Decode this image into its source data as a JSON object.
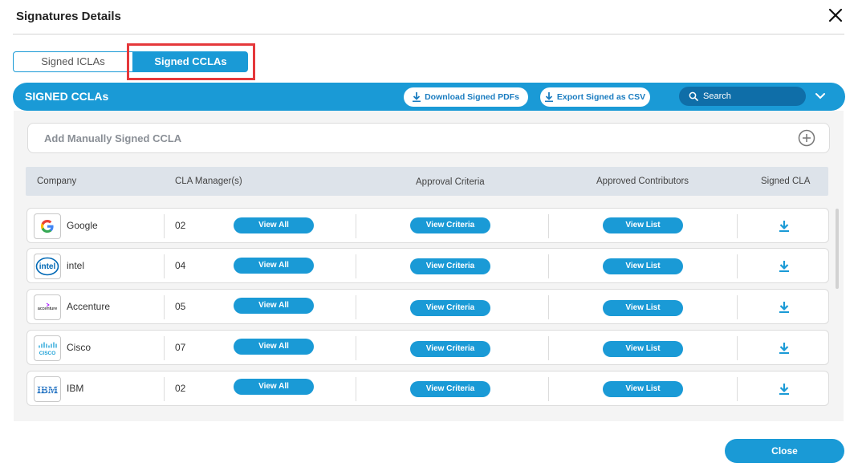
{
  "dialog": {
    "title": "Signatures Details"
  },
  "tabs": [
    {
      "label": "Signed ICLAs",
      "active": false
    },
    {
      "label": "Signed CCLAs",
      "active": true
    }
  ],
  "toolbar": {
    "title": "SIGNED CCLAs",
    "download_pdfs_label": "Download Signed PDFs",
    "export_csv_label": "Export Signed as CSV",
    "search_placeholder": "Search"
  },
  "add_manual": {
    "label": "Add Manually Signed CCLA"
  },
  "table": {
    "headers": {
      "company": "Company",
      "managers": "CLA Manager(s)",
      "criteria": "Approval Criteria",
      "contributors": "Approved Contributors",
      "signed": "Signed CLA"
    },
    "view_all_label": "View All",
    "view_criteria_label": "View Criteria",
    "view_list_label": "View List",
    "rows": [
      {
        "company": "Google",
        "managers": "02",
        "logo": "google-logo"
      },
      {
        "company": "intel",
        "managers": "04",
        "logo": "intel-logo"
      },
      {
        "company": "Accenture",
        "managers": "05",
        "logo": "accenture-logo"
      },
      {
        "company": "Cisco",
        "managers": "07",
        "logo": "cisco-logo"
      },
      {
        "company": "IBM",
        "managers": "02",
        "logo": "ibm-logo"
      }
    ]
  },
  "footer": {
    "close_label": "Close"
  },
  "logo_text": {
    "intel": "intel",
    "accenture": "accenture",
    "cisco": "CISCO",
    "ibm": "IBM"
  },
  "colors": {
    "primary": "#1a9ad6",
    "search_bg": "#0f6ea8",
    "highlight": "#e5383b"
  }
}
